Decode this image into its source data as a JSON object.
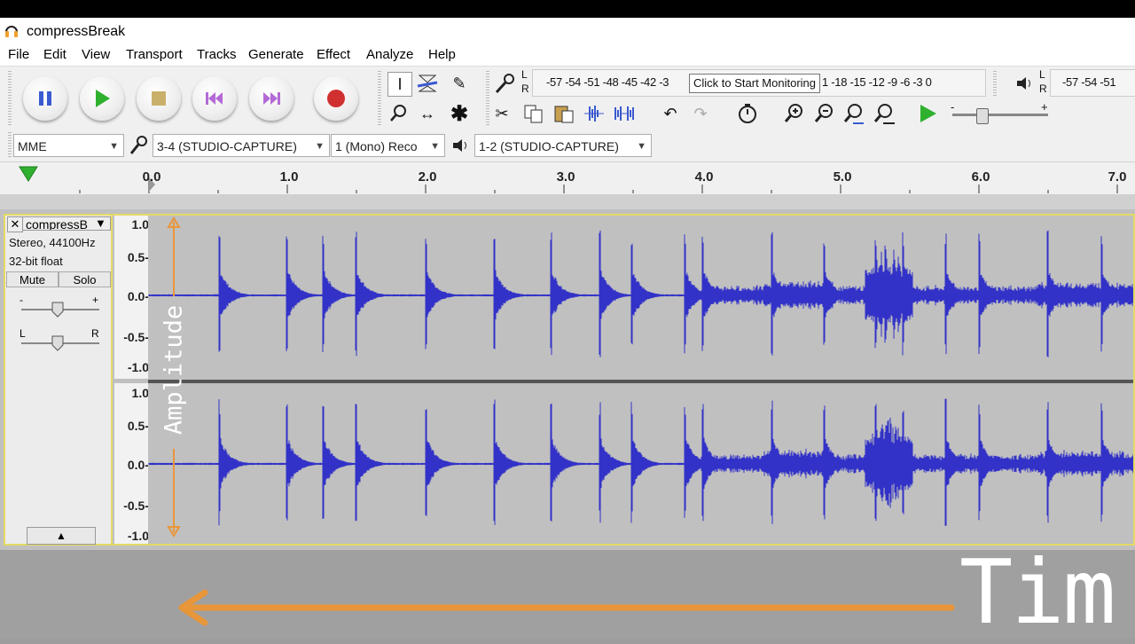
{
  "app": {
    "title": "compressBreak"
  },
  "menu": [
    "File",
    "Edit",
    "View",
    "Transport",
    "Tracks",
    "Generate",
    "Effect",
    "Analyze",
    "Help"
  ],
  "transport": {
    "buttons": [
      "pause",
      "play",
      "stop",
      "skip-start",
      "skip-end",
      "record"
    ]
  },
  "meters": {
    "record_scale": "-57 -54 -51 -48 -45 -42 -3",
    "record_scale_right": "1 -18 -15 -12  -9  -6  -3  0",
    "tooltip": "Click to Start Monitoring",
    "play_scale": "-57 -54 -51",
    "lr_top": "L",
    "lr_bottom": "R"
  },
  "devices": {
    "host": "MME",
    "input": "3-4 (STUDIO-CAPTURE)",
    "channels": "1 (Mono) Reco",
    "output": "1-2 (STUDIO-CAPTURE)"
  },
  "ruler": {
    "ticks": [
      "0.0",
      "1.0",
      "2.0",
      "3.0",
      "4.0",
      "5.0",
      "6.0",
      "7.0"
    ]
  },
  "track": {
    "name": "compressB",
    "format": "Stereo, 44100Hz",
    "bits": "32-bit float",
    "mute": "Mute",
    "solo": "Solo",
    "gain_minus": "-",
    "gain_plus": "+",
    "pan_left": "L",
    "pan_right": "R",
    "amp_ticks": [
      "1.0",
      "0.5-",
      "0.0-",
      "-0.5-",
      "-1.0"
    ],
    "amp_ticks2": [
      "1.0",
      "0.5-",
      "0.0-",
      "-0.5-",
      "-1.0"
    ]
  },
  "annotations": {
    "amplitude": "Amplitude",
    "time": "Tim"
  },
  "colors": {
    "waveform": "#3232c8",
    "accent": "#e8963a",
    "selection": "#e4da65"
  }
}
